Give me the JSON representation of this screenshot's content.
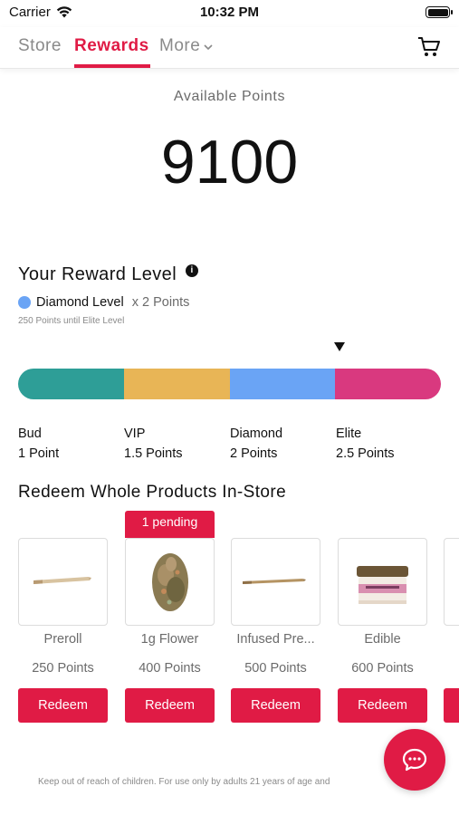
{
  "status_bar": {
    "carrier": "Carrier",
    "time": "10:32 PM"
  },
  "nav": {
    "tabs": [
      {
        "label": "Store",
        "active": false
      },
      {
        "label": "Rewards",
        "active": true
      },
      {
        "label": "More",
        "active": false
      }
    ],
    "accent_color": "#e01b45",
    "cart_icon": "cart-icon"
  },
  "points": {
    "label": "Available Points",
    "value": "9100"
  },
  "reward_level": {
    "title": "Your Reward Level",
    "current_level": "Diamond Level",
    "multiplier": "x 2 Points",
    "until_next": "250 Points until Elite Level",
    "tiers": [
      {
        "name": "Bud",
        "points": "1 Point",
        "color": "#2e9e97"
      },
      {
        "name": "VIP",
        "points": "1.5 Points",
        "color": "#e8b556"
      },
      {
        "name": "Diamond",
        "points": "2 Points",
        "color": "#6aa4f5"
      },
      {
        "name": "Elite",
        "points": "2.5 Points",
        "color": "#d9397f"
      }
    ],
    "progress_fraction": 0.75
  },
  "redeem": {
    "title": "Redeem Whole Products In-Store",
    "button_label": "Redeem",
    "products": [
      {
        "name": "Preroll",
        "points": "250 Points",
        "pending": ""
      },
      {
        "name": "1g Flower",
        "points": "400 Points",
        "pending": "1 pending"
      },
      {
        "name": "Infused Pre...",
        "points": "500 Points",
        "pending": ""
      },
      {
        "name": "Edible",
        "points": "600 Points",
        "pending": ""
      }
    ]
  },
  "footer": {
    "disclaimer": "Keep out of reach of children. For use only by adults 21 years of age and"
  }
}
